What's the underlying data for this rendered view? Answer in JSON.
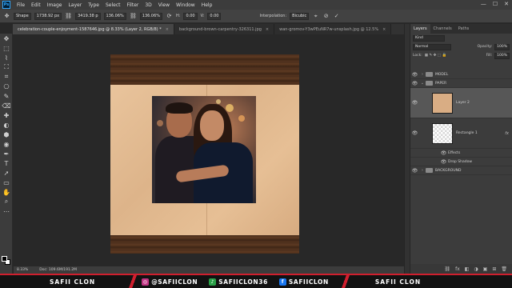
{
  "app": {
    "logo": "Ps"
  },
  "menu": [
    "File",
    "Edit",
    "Image",
    "Layer",
    "Type",
    "Select",
    "Filter",
    "3D",
    "View",
    "Window",
    "Help"
  ],
  "window_controls": [
    "—",
    "☐",
    "✕"
  ],
  "options": {
    "mode": "Shape",
    "width": "1738.92 px",
    "height": "3419.38 p",
    "scale": "136.06%",
    "scale2": "136.06%",
    "h_label": "H:",
    "h_value": "0.00",
    "v_label": "V:",
    "v_value": "0.00",
    "interp_label": "Interpolation:",
    "interpolation": "Bicubic"
  },
  "tabs": [
    {
      "label": "celebration-couple-enjoyment-1587646.jpg @ 8.33% (Layer 2, RGB/8) *",
      "active": true
    },
    {
      "label": "background-brown-carpentry-326311.jpg",
      "active": false
    },
    {
      "label": "wan-gromov-Y3wPEuNR7w-unsplash.jpg @ 12.5%",
      "active": false
    }
  ],
  "tools": [
    "✥",
    "⬚",
    "⌇",
    "⛶",
    "⌗",
    "⎔",
    "✎",
    "⌫",
    "✚",
    "◐",
    "⬢",
    "◉",
    "✒",
    "T",
    "➚",
    "▭",
    "✋",
    "⌕",
    "⋯"
  ],
  "status": {
    "zoom": "8.33%",
    "doc": "Doc: 109.6M/191.2M"
  },
  "panel": {
    "tabs": [
      "Layers",
      "Channels",
      "Paths"
    ],
    "kind": "Kind",
    "blend": "Normal",
    "opacity_label": "Opacity:",
    "opacity": "100%",
    "lock_label": "Lock:",
    "fill_label": "Fill:",
    "fill": "100%",
    "layers": {
      "model": "MODEL",
      "paper": "PAPER",
      "layer2": "Layer 2",
      "rect": "Rectangle 1",
      "effects": "Effects",
      "drop_shadow": "Drop Shadow",
      "background": "BACKGROUND"
    },
    "bottom_icons": [
      "⛓",
      "fx",
      "◧",
      "◑",
      "▣",
      "⊞",
      "🗑"
    ]
  },
  "social": {
    "left": "SAFII CLON",
    "instagram": "@SAFIICLON",
    "tiktok": "SAFIICLON36",
    "facebook": "SAFIICLON",
    "right": "SAFII CLON",
    "colors": {
      "accent": "#d01f2e",
      "instagram": "#c13584",
      "tiktok": "#2aa148",
      "facebook": "#1877f2"
    }
  }
}
